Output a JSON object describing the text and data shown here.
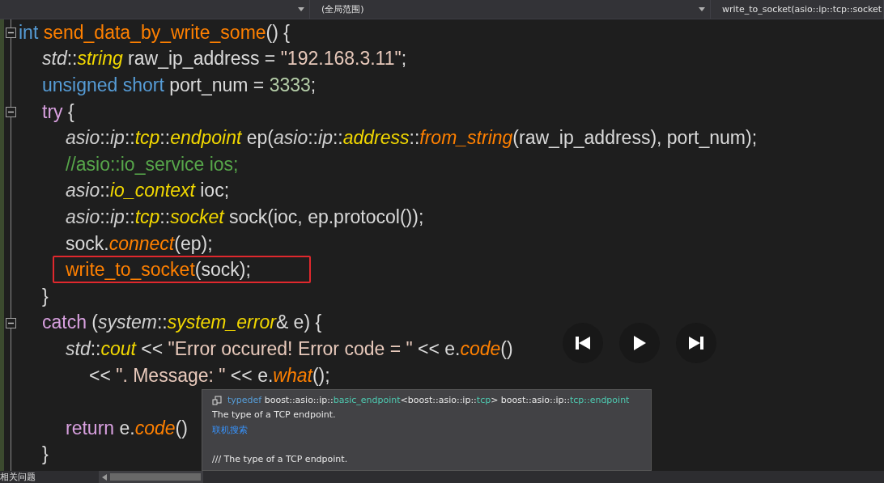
{
  "navigation_bar": {
    "scope": "(全局范围)",
    "member": "write_to_socket(asio::ip::tcp::socket"
  },
  "code_lines": [
    {
      "kind": "code",
      "fold": true,
      "highlighted": false,
      "tokens": [
        {
          "t": "int ",
          "kind": "kw"
        },
        {
          "t": "send_data_by_write_some",
          "kind": "fnplain"
        },
        {
          "t": "() {",
          "kind": "text"
        }
      ],
      "children": [
        {
          "kind": "code",
          "fold": false,
          "highlighted": false,
          "tokens": [
            {
              "t": "std",
              "kind": "ns"
            },
            {
              "t": "::",
              "kind": "text"
            },
            {
              "t": "string",
              "kind": "type"
            },
            {
              "t": " raw_ip_address = ",
              "kind": "text"
            },
            {
              "t": "\"192.168.3.11\"",
              "kind": "str"
            },
            {
              "t": ";",
              "kind": "text"
            }
          ]
        },
        {
          "kind": "code",
          "fold": false,
          "highlighted": false,
          "tokens": [
            {
              "t": "unsigned short ",
              "kind": "kw"
            },
            {
              "t": "port_num = ",
              "kind": "text"
            },
            {
              "t": "3333",
              "kind": "num"
            },
            {
              "t": ";",
              "kind": "text"
            }
          ]
        },
        {
          "kind": "code",
          "fold": true,
          "highlighted": false,
          "tokens": [
            {
              "t": "try",
              "kind": "kw2"
            },
            {
              "t": " {",
              "kind": "text"
            }
          ],
          "children": [
            {
              "kind": "code",
              "fold": false,
              "highlighted": false,
              "tokens": [
                {
                  "t": "asio",
                  "kind": "ns"
                },
                {
                  "t": "::",
                  "kind": "text"
                },
                {
                  "t": "ip",
                  "kind": "ns"
                },
                {
                  "t": "::",
                  "kind": "text"
                },
                {
                  "t": "tcp",
                  "kind": "type"
                },
                {
                  "t": "::",
                  "kind": "text"
                },
                {
                  "t": "endpoint",
                  "kind": "type"
                },
                {
                  "t": " ep(",
                  "kind": "text"
                },
                {
                  "t": "asio",
                  "kind": "ns"
                },
                {
                  "t": "::",
                  "kind": "text"
                },
                {
                  "t": "ip",
                  "kind": "ns"
                },
                {
                  "t": "::",
                  "kind": "text"
                },
                {
                  "t": "address",
                  "kind": "type"
                },
                {
                  "t": "::",
                  "kind": "text"
                },
                {
                  "t": "from_string",
                  "kind": "fn"
                },
                {
                  "t": "(raw_ip_address), port_num);",
                  "kind": "text"
                }
              ]
            },
            {
              "kind": "code",
              "fold": false,
              "highlighted": false,
              "tokens": [
                {
                  "t": "//asio::io_service ios;",
                  "kind": "comment"
                }
              ]
            },
            {
              "kind": "code",
              "fold": false,
              "highlighted": false,
              "tokens": [
                {
                  "t": "asio",
                  "kind": "ns"
                },
                {
                  "t": "::",
                  "kind": "text"
                },
                {
                  "t": "io_context",
                  "kind": "type"
                },
                {
                  "t": " ioc;",
                  "kind": "text"
                }
              ]
            },
            {
              "kind": "code",
              "fold": false,
              "highlighted": false,
              "tokens": [
                {
                  "t": "asio",
                  "kind": "ns"
                },
                {
                  "t": "::",
                  "kind": "text"
                },
                {
                  "t": "ip",
                  "kind": "ns"
                },
                {
                  "t": "::",
                  "kind": "text"
                },
                {
                  "t": "tcp",
                  "kind": "type"
                },
                {
                  "t": "::",
                  "kind": "text"
                },
                {
                  "t": "socket",
                  "kind": "type"
                },
                {
                  "t": " sock(ioc, ep.protocol());",
                  "kind": "text"
                }
              ]
            },
            {
              "kind": "code",
              "fold": false,
              "highlighted": false,
              "tokens": [
                {
                  "t": "sock.",
                  "kind": "text"
                },
                {
                  "t": "connect",
                  "kind": "fn"
                },
                {
                  "t": "(ep);",
                  "kind": "text"
                }
              ]
            },
            {
              "kind": "code",
              "fold": false,
              "highlighted": true,
              "tokens": [
                {
                  "t": "write_to_socket",
                  "kind": "fnplain"
                },
                {
                  "t": "(sock);",
                  "kind": "text"
                }
              ]
            }
          ]
        },
        {
          "kind": "code",
          "fold": false,
          "highlighted": false,
          "tokens": [
            {
              "t": "}",
              "kind": "text"
            }
          ]
        },
        {
          "kind": "code",
          "fold": true,
          "highlighted": false,
          "tokens": [
            {
              "t": "catch",
              "kind": "kw2"
            },
            {
              "t": " (",
              "kind": "text"
            },
            {
              "t": "system",
              "kind": "ns"
            },
            {
              "t": "::",
              "kind": "text"
            },
            {
              "t": "system_error",
              "kind": "type"
            },
            {
              "t": "& e) {",
              "kind": "text"
            }
          ],
          "children": [
            {
              "kind": "code",
              "fold": false,
              "highlighted": false,
              "tokens": [
                {
                  "t": "std",
                  "kind": "ns"
                },
                {
                  "t": "::",
                  "kind": "text"
                },
                {
                  "t": "cout",
                  "kind": "type"
                },
                {
                  "t": " << ",
                  "kind": "text"
                },
                {
                  "t": "\"Error occured! Error code = \"",
                  "kind": "str"
                },
                {
                  "t": " << e.",
                  "kind": "text"
                },
                {
                  "t": "code",
                  "kind": "fn"
                },
                {
                  "t": "()",
                  "kind": "text"
                }
              ],
              "children": [
                {
                  "kind": "code",
                  "fold": false,
                  "highlighted": false,
                  "tokens": [
                    {
                      "t": "<< ",
                      "kind": "text"
                    },
                    {
                      "t": "\". Message: \"",
                      "kind": "str"
                    },
                    {
                      "t": " << e.",
                      "kind": "text"
                    },
                    {
                      "t": "what",
                      "kind": "fn"
                    },
                    {
                      "t": "();",
                      "kind": "text"
                    }
                  ]
                }
              ]
            },
            {
              "kind": "blank"
            },
            {
              "kind": "code",
              "fold": false,
              "highlighted": false,
              "tokens": [
                {
                  "t": "return ",
                  "kind": "kw2"
                },
                {
                  "t": "e.",
                  "kind": "text"
                },
                {
                  "t": "code",
                  "kind": "fn"
                },
                {
                  "t": "()",
                  "kind": "text"
                }
              ]
            }
          ]
        },
        {
          "kind": "code",
          "fold": false,
          "highlighted": false,
          "tokens": [
            {
              "t": "}",
              "kind": "text"
            }
          ]
        }
      ]
    }
  ],
  "tooltip": {
    "signature": [
      {
        "t": "typedef",
        "kind": "kw"
      },
      {
        "t": " boost::asio::ip::",
        "kind": "text"
      },
      {
        "t": "basic_endpoint",
        "kind": "type"
      },
      {
        "t": "<boost::asio::ip::",
        "kind": "text"
      },
      {
        "t": "tcp",
        "kind": "type"
      },
      {
        "t": "> boost::asio::ip::",
        "kind": "text"
      },
      {
        "t": "tcp::endpoint",
        "kind": "type"
      }
    ],
    "description": "The type of a TCP endpoint.",
    "link": "联机搜索",
    "comment": "/// The type of a TCP endpoint."
  },
  "status_bar": {
    "label": "相关问题"
  }
}
